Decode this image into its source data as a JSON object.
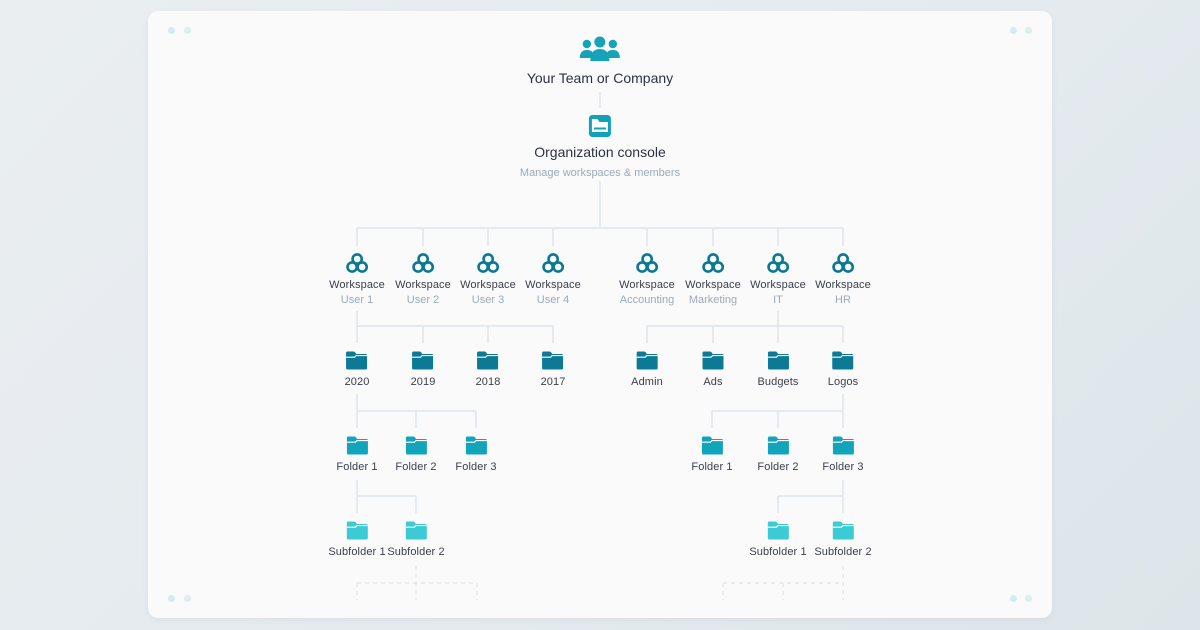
{
  "colors": {
    "team_icon": "#16a3b9",
    "console_icon": "#11a2b9",
    "workspace_icon": "#0b7893",
    "folder_level1": "#0c7a95",
    "folder_level2": "#12a4ba",
    "folder_level3": "#3ccbd4",
    "line": "#dde5ec"
  },
  "root": {
    "icon": "team-icon",
    "label": "Your Team or Company"
  },
  "console": {
    "icon": "console-icon",
    "label": "Organization console",
    "sublabel": "Manage workspaces & members"
  },
  "workspaces": [
    {
      "label": "Workspace",
      "sublabel": "User 1"
    },
    {
      "label": "Workspace",
      "sublabel": "User 2"
    },
    {
      "label": "Workspace",
      "sublabel": "User 3"
    },
    {
      "label": "Workspace",
      "sublabel": "User 4"
    },
    {
      "label": "Workspace",
      "sublabel": "Accounting"
    },
    {
      "label": "Workspace",
      "sublabel": "Marketing"
    },
    {
      "label": "Workspace",
      "sublabel": "IT"
    },
    {
      "label": "Workspace",
      "sublabel": "HR"
    }
  ],
  "left_branch": {
    "parent": "User 1",
    "folders": [
      "2020",
      "2019",
      "2018",
      "2017"
    ],
    "subfolders_parent": "2020",
    "subfolders": [
      "Folder 1",
      "Folder 2",
      "Folder 3"
    ],
    "subsub_parent": "Folder 1",
    "subsubfolders": [
      "Subfolder 1",
      "Subfolder 2"
    ]
  },
  "right_branch": {
    "parent": "IT",
    "folders": [
      "Admin",
      "Ads",
      "Budgets",
      "Logos"
    ],
    "subfolders_parent": "Logos",
    "subfolders": [
      "Folder 1",
      "Folder 2",
      "Folder 3"
    ],
    "subsub_parent": "Folder 3",
    "subsubfolders": [
      "Subfolder 1",
      "Subfolder 2"
    ]
  }
}
